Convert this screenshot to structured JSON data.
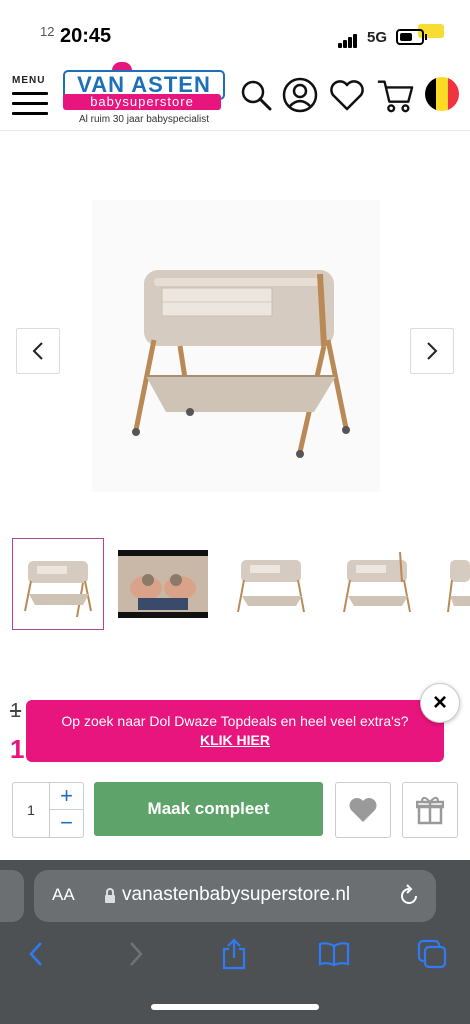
{
  "status_bar": {
    "corner_text": "12",
    "time": "20:45",
    "network": "5G"
  },
  "header": {
    "menu_label": "MENU",
    "logo_name": "VAN ASTEN",
    "logo_sub": "babysuperstore",
    "tagline": "Al ruim 30 jaar babyspecialist",
    "icons": [
      "search-icon",
      "account-icon",
      "heart-icon",
      "cart-icon",
      "belgium-flag-icon"
    ]
  },
  "product": {
    "image_subject": "bedside crib",
    "price_old": "1",
    "price_new": "1"
  },
  "promo": {
    "text": "Op zoek naar Dol Dwaze Topdeals en heel veel extra's?",
    "link": "KLIK HIER",
    "close_symbol": "×"
  },
  "cart_row": {
    "quantity": "1",
    "plus": "+",
    "minus": "−",
    "cta_label": "Maak compleet"
  },
  "browser": {
    "aa_label": "AA",
    "url": "vanastenbabysuperstore.nl"
  },
  "colors": {
    "brand_blue": "#1d6fb8",
    "brand_pink": "#e8157e",
    "cta_green": "#5da36a",
    "safari_bar": "#4d5154"
  }
}
